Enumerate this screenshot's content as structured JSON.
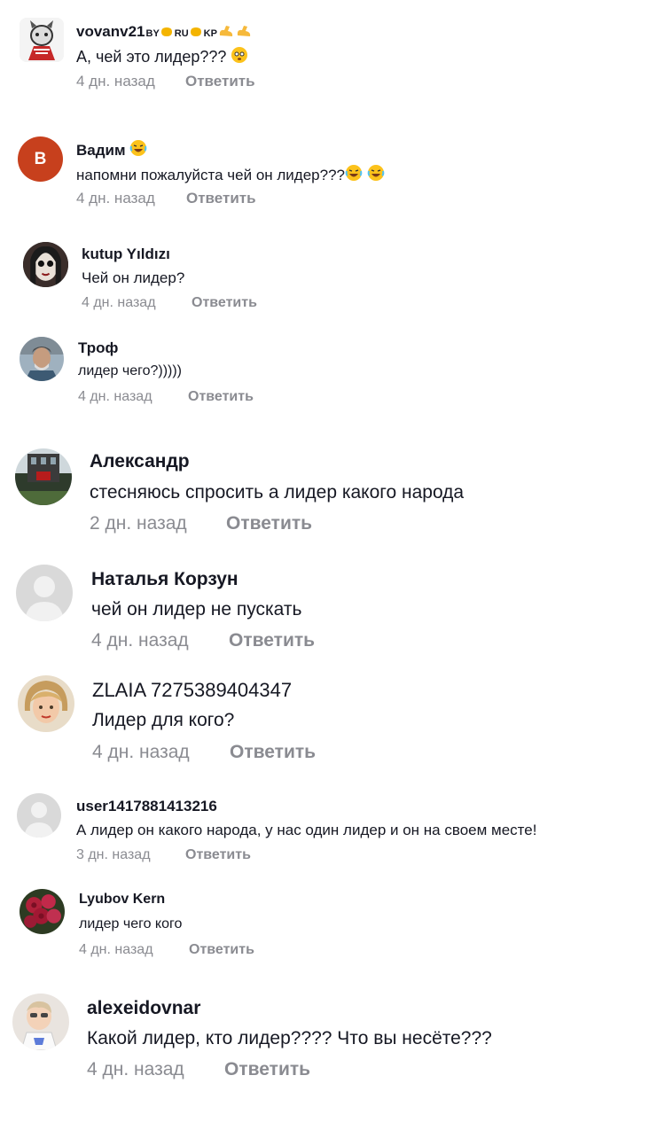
{
  "comments": [
    {
      "name": "vovanv21",
      "text": "А, чей это лидер???",
      "time": "4 дн. назад",
      "reply": "Ответить"
    },
    {
      "name": "Вадим",
      "text": "напомни пожалуйста чей он лидер???",
      "time": "4 дн. назад",
      "reply": "Ответить",
      "avatar_letter": "B"
    },
    {
      "name": "kutup Yıldızı",
      "text": "Чей он лидер?",
      "time": "4 дн. назад",
      "reply": "Ответить"
    },
    {
      "name": "Троф",
      "text": "лидер чего?)))))",
      "time": "4 дн. назад",
      "reply": "Ответить"
    },
    {
      "name": "Александр",
      "text": "стесняюсь спросить а лидер какого народа",
      "time": "2 дн. назад",
      "reply": "Ответить"
    },
    {
      "name": "Наталья Корзун",
      "text": "чей он лидер не пускать",
      "time": "4 дн. назад",
      "reply": "Ответить"
    },
    {
      "name": "ZLAIA 7275389404347",
      "text": "Лидер для кого?",
      "time": "4 дн. назад",
      "reply": "Ответить"
    },
    {
      "name": "user1417881413216",
      "text": "А лидер он какого народа, у нас один лидер и он на своем месте!",
      "time": "3 дн. назад",
      "reply": "Ответить"
    },
    {
      "name": "Lyubov Kern",
      "text": "лидер чего кого",
      "time": "4 дн. назад",
      "reply": "Ответить"
    },
    {
      "name": "alexeidovnar",
      "text": "Какой лидер, кто лидер???? Что вы несёте???",
      "time": "4 дн. назад",
      "reply": "Ответить"
    }
  ],
  "badges": {
    "by": "BY",
    "ru": "RU",
    "kp": "KP"
  },
  "colors": {
    "vadim_avatar": "#c7401d",
    "meta": "#8a8b91",
    "placeholder_avatar": "#d9d9d9"
  }
}
